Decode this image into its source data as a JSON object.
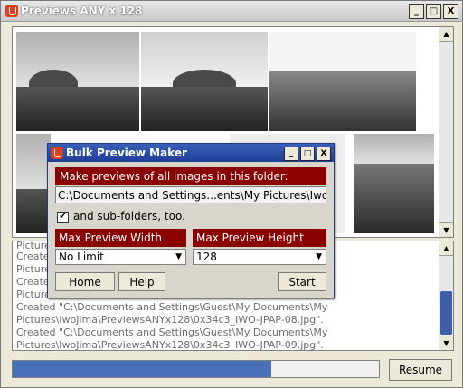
{
  "window": {
    "title": "Previews ANY x 128",
    "min_glyph": "_",
    "max_glyph": "□",
    "close_glyph": "X"
  },
  "log": {
    "lines": [
      "Picture",
      "Created",
      "Picture",
      "Created",
      "Picture",
      "Created \"C:\\Documents and Settings\\Guest\\My Documents\\My",
      "Pictures\\IwoJima\\PreviewsANYx128\\0x34c3_IWO-JPAP-08.jpg\".",
      "Created \"C:\\Documents and Settings\\Guest\\My Documents\\My",
      "Pictures\\IwoJima\\PreviewsANYx128\\0x34c3_IWO-JPAP-09.jpg\"."
    ]
  },
  "progress": {
    "value": 0.705
  },
  "resume_button": "Resume",
  "dialog": {
    "title": "Bulk Preview Maker",
    "min_glyph": "_",
    "max_glyph": "□",
    "close_glyph": "X",
    "folder_label": "Make previews of all images in this folder:",
    "folder_path": "C:\\Documents and Settings...ents\\My Pictures\\IwoJima",
    "subfolders_checked": true,
    "subfolders_label": "and sub-folders, too.",
    "width_label": "Max Preview Width",
    "height_label": "Max Preview Height",
    "width_value": "No Limit",
    "height_value": "128",
    "home_button": "Home",
    "help_button": "Help",
    "start_button": "Start"
  },
  "icons": {
    "up_arrow": "▲",
    "down_arrow": "▼",
    "caret": "▼",
    "check": "✔"
  }
}
